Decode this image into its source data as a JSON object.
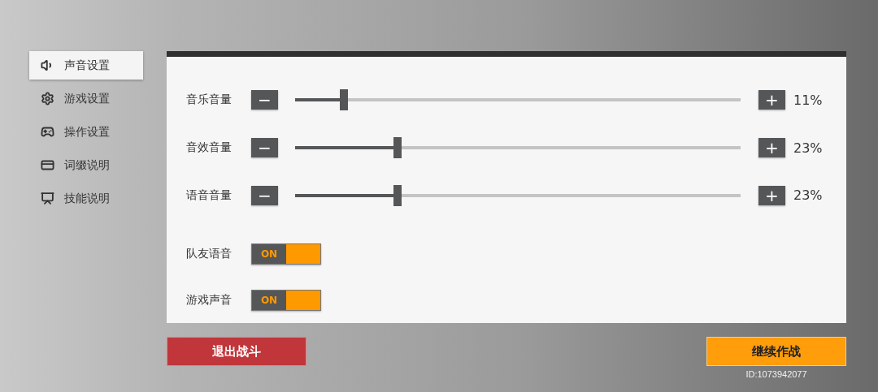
{
  "sidebar": {
    "items": [
      {
        "label": "声音设置",
        "selected": true
      },
      {
        "label": "游戏设置",
        "selected": false
      },
      {
        "label": "操作设置",
        "selected": false
      },
      {
        "label": "词缀说明",
        "selected": false
      },
      {
        "label": "技能说明",
        "selected": false
      }
    ]
  },
  "settings": [
    {
      "kind": "slider",
      "label": "音乐音量",
      "minus": "−",
      "plus": "+",
      "level": 0.11,
      "reading": "11%"
    },
    {
      "kind": "slider",
      "label": "音效音量",
      "minus": "−",
      "plus": "+",
      "level": 0.23,
      "reading": "23%"
    },
    {
      "kind": "slider",
      "label": "语音音量",
      "minus": "−",
      "plus": "+",
      "level": 0.23,
      "reading": "23%"
    },
    {
      "kind": "toggle",
      "label": "队友语音",
      "on": true,
      "state_label": "ON"
    },
    {
      "kind": "toggle",
      "label": "游戏声音",
      "on": true,
      "state_label": "ON"
    }
  ],
  "buttons": {
    "exit": "退出战斗",
    "continue": "继续作战"
  },
  "player_id": "ID:1073942077"
}
